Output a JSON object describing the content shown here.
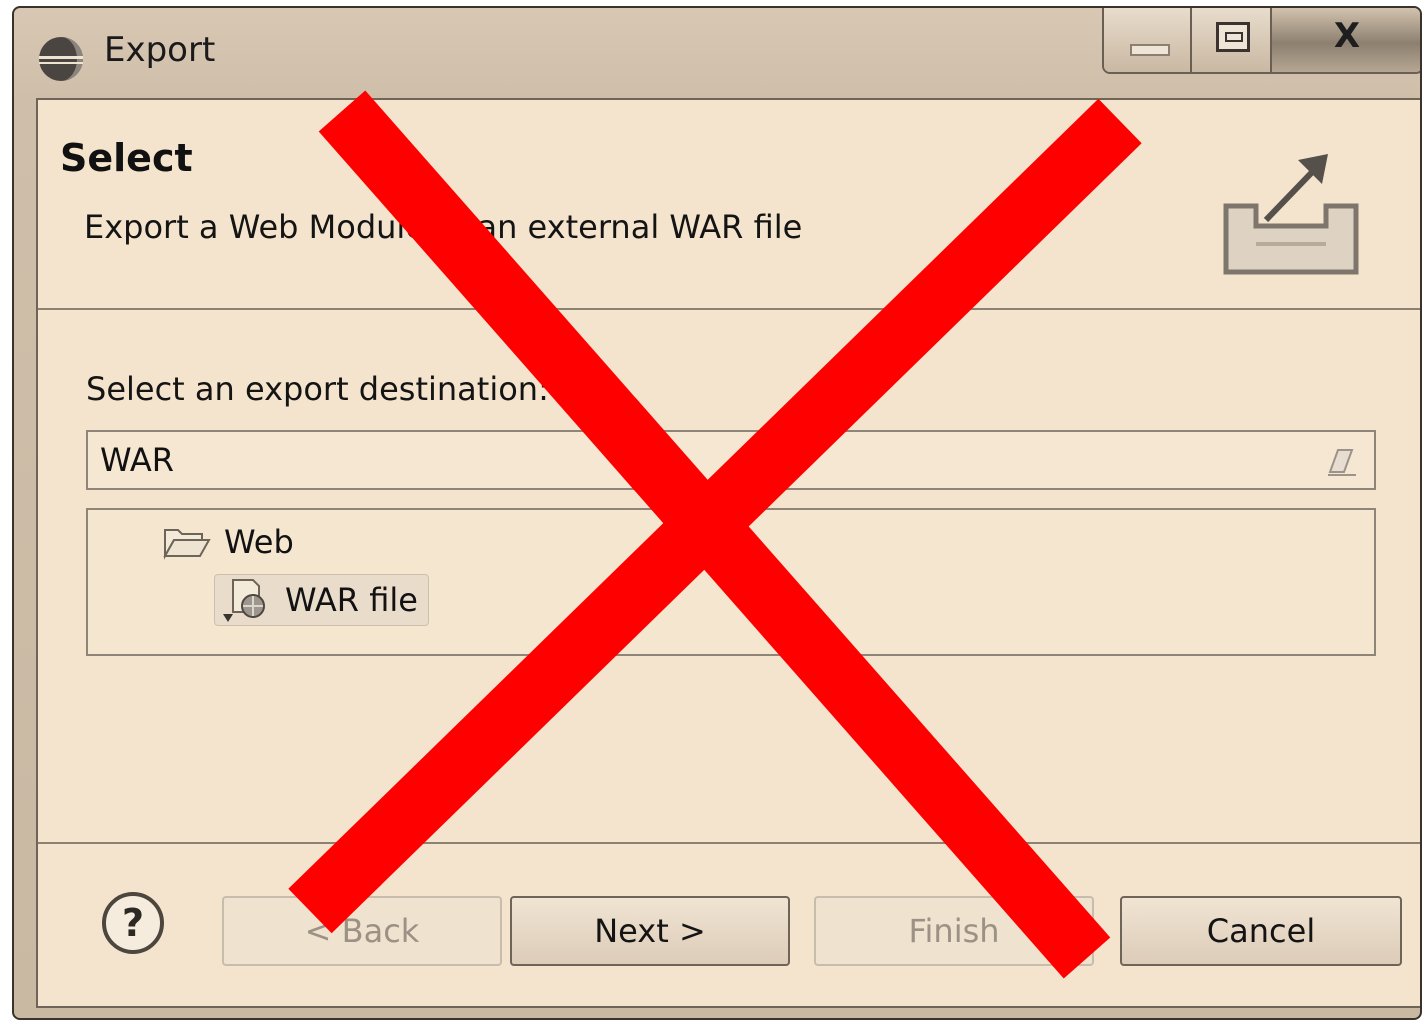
{
  "window": {
    "title": "Export",
    "controls": {
      "minimize_icon": "minimize-icon",
      "maximize_icon": "maximize-icon",
      "close_label": "X"
    }
  },
  "header": {
    "title": "Select",
    "description": "Export a Web Module to an external WAR file",
    "banner_icon": "export-icon"
  },
  "body": {
    "destination_label": "Select an export destination:",
    "filter": {
      "value": "WAR",
      "clear_icon": "clear-eraser-icon"
    },
    "tree": {
      "category": {
        "label": "Web",
        "icon": "folder-open-icon"
      },
      "item": {
        "label": "WAR file",
        "icon": "war-file-icon",
        "selected": true
      }
    }
  },
  "footer": {
    "help_icon": "help-icon",
    "buttons": {
      "back": "< Back",
      "next": "Next >",
      "finish": "Finish",
      "cancel": "Cancel"
    }
  },
  "overlay": {
    "type": "red-x",
    "color": "#ff0000"
  },
  "colors": {
    "dialog_background": "#f4e4cd",
    "frame": "#cfbfaa",
    "overlay_red": "#ff0000"
  }
}
